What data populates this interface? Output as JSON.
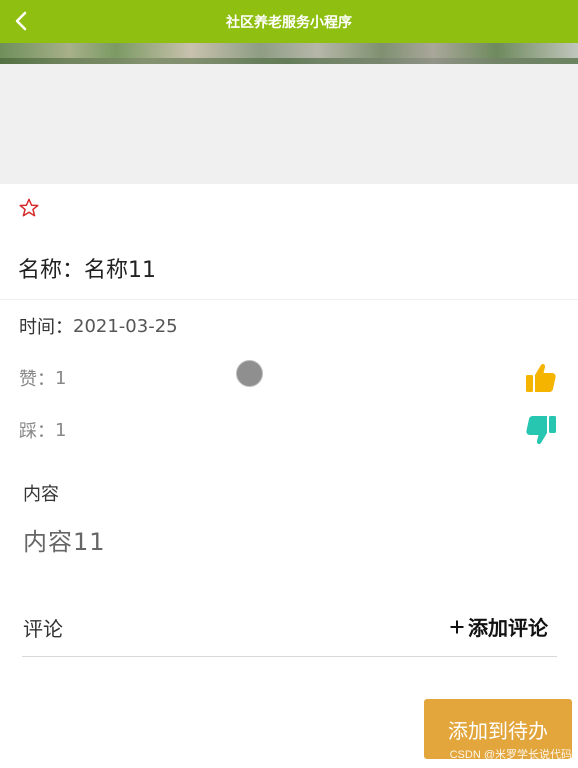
{
  "header": {
    "title": "社区养老服务小程序",
    "background_color": "#8fbf10",
    "back_icon": "chevron-left-icon"
  },
  "detail": {
    "favorite_icon": "star-outline-icon",
    "name_label": "名称：",
    "name_value": "名称11",
    "time_label": "时间：",
    "time_value": "2021-03-25",
    "like_label": "赞：",
    "like_count": "1",
    "like_icon": "thumbs-up-icon",
    "like_color": "#f5b400",
    "dislike_label": "踩：",
    "dislike_count": "1",
    "dislike_icon": "thumbs-down-icon",
    "dislike_color": "#26c6b0"
  },
  "content": {
    "label": "内容",
    "value": "内容11"
  },
  "comments": {
    "label": "评论",
    "add_label": "添加评论"
  },
  "actions": {
    "add_todo_label": "添加到待办",
    "add_todo_color": "#e3a63c"
  },
  "watermark": "CSDN @米罗学长说代码"
}
